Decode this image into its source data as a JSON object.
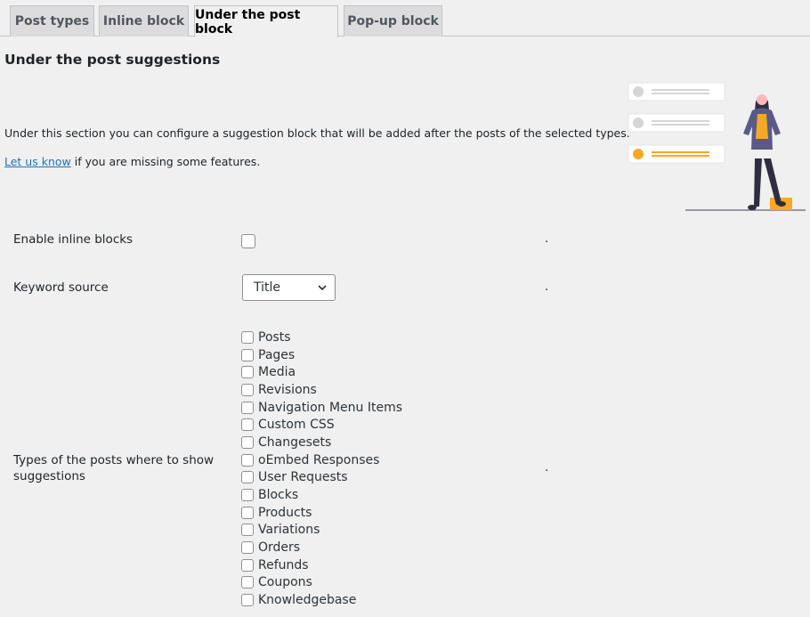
{
  "tabs": [
    {
      "label": "Post types",
      "active": false
    },
    {
      "label": "Inline block",
      "active": false
    },
    {
      "label": "Under the post block",
      "active": true
    },
    {
      "label": "Pop-up block",
      "active": false
    }
  ],
  "section": {
    "title": "Under the post suggestions",
    "description": "Under this section you can configure a suggestion block that will be added after the posts of the selected types.",
    "link_text": "Let us know",
    "link_suffix": " if you are missing some features."
  },
  "settings": {
    "enable_inline": {
      "label": "Enable inline blocks",
      "checked": false,
      "note": "."
    },
    "keyword_source": {
      "label": "Keyword source",
      "value": "Title",
      "note": "."
    },
    "post_types": {
      "label": "Types of the posts where to show suggestions",
      "note": ".",
      "options": [
        "Posts",
        "Pages",
        "Media",
        "Revisions",
        "Navigation Menu Items",
        "Custom CSS",
        "Changesets",
        "oEmbed Responses",
        "User Requests",
        "Blocks",
        "Products",
        "Variations",
        "Orders",
        "Refunds",
        "Coupons",
        "Knowledgebase"
      ]
    }
  },
  "colors": {
    "accent": "#f9a825",
    "link": "#2271b1",
    "figure_jacket": "#5a5a8a"
  }
}
